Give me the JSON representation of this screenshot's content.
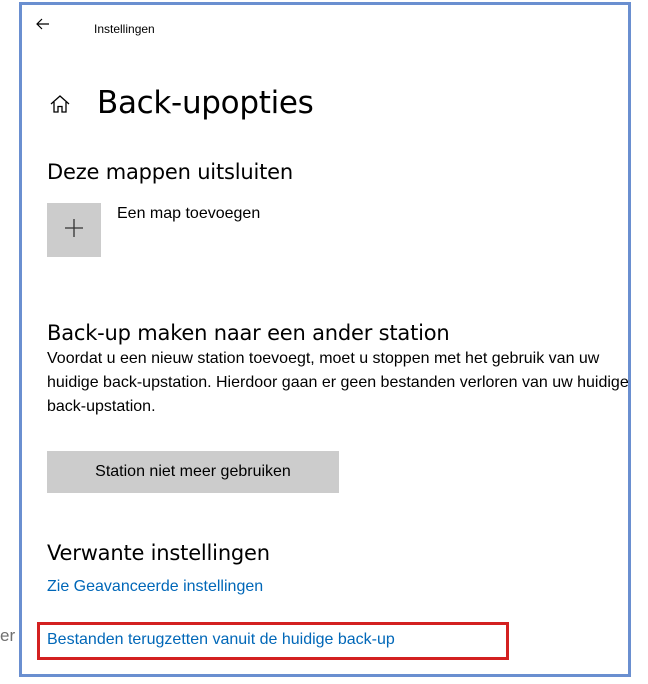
{
  "outside": {
    "cut_text": "er"
  },
  "window": {
    "title": "Instellingen",
    "back_icon": "back-arrow-icon"
  },
  "page": {
    "home_icon": "home-icon",
    "title": "Back-upopties"
  },
  "exclude_section": {
    "heading": "Deze mappen uitsluiten",
    "add_icon": "plus-icon",
    "add_label": "Een map toevoegen"
  },
  "other_drive_section": {
    "heading": "Back-up maken naar een ander station",
    "description": "Voordat u een nieuw station toevoegt, moet u stoppen met het gebruik van uw huidige back-upstation. Hierdoor gaan er geen bestanden verloren van uw huidige back-upstation.",
    "button_label": "Station niet meer gebruiken"
  },
  "related_section": {
    "heading": "Verwante instellingen",
    "link_advanced": "Zie Geavanceerde instellingen",
    "link_restore": "Bestanden terugzetten vanuit de huidige back-up"
  },
  "colors": {
    "link": "#0067b8",
    "tile": "#cccccc",
    "window_border": "#6a8fd0",
    "highlight": "#d32020"
  }
}
